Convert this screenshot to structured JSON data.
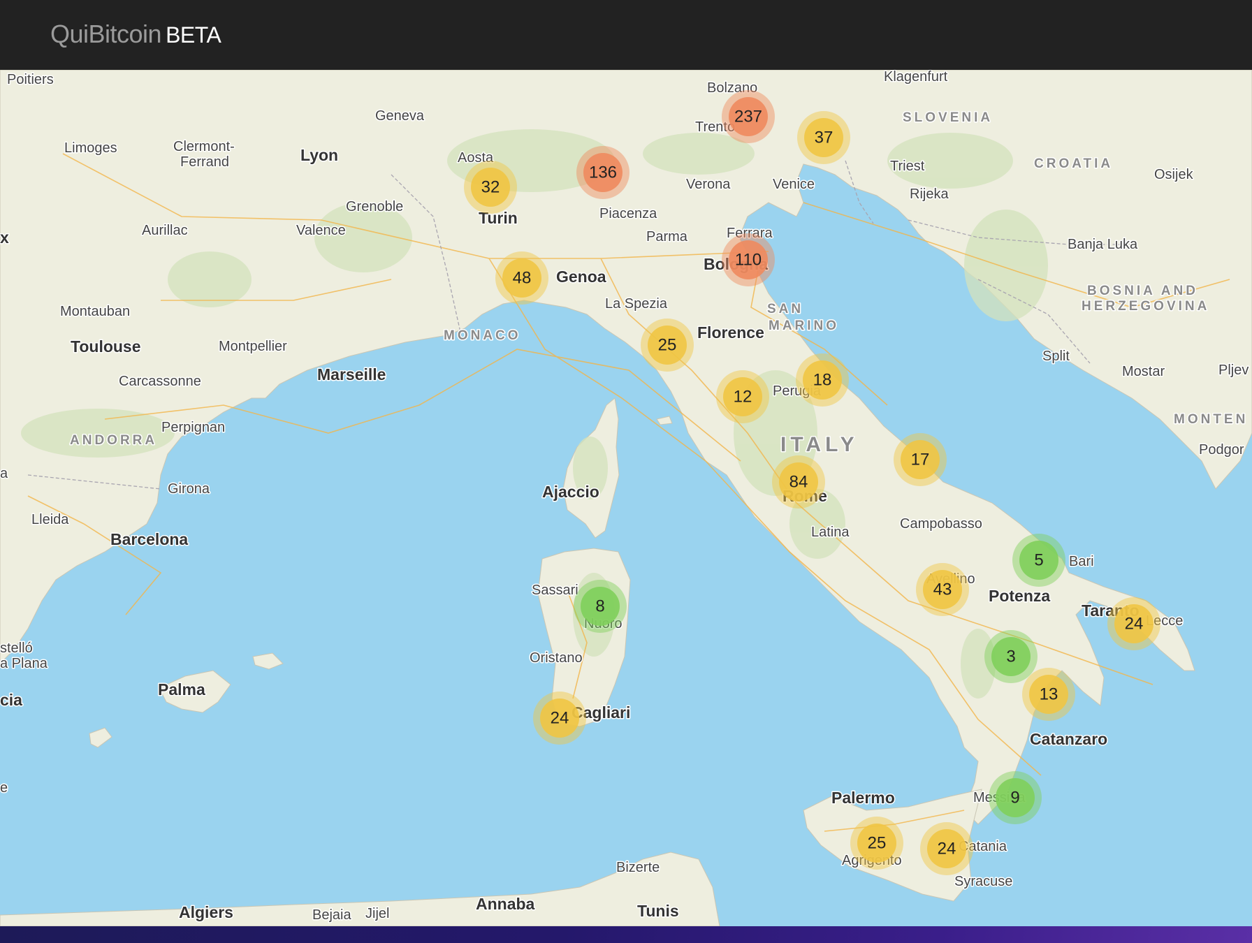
{
  "header": {
    "app_name": "QuiBitcoin",
    "badge": "BETA"
  },
  "colors": {
    "topbar": "#222222",
    "sea": "#9ad3ef",
    "land": "#f1efe4",
    "cluster_small": "#7fcf5b",
    "cluster_medium": "#efc544",
    "cluster_large": "#ee8a5e"
  },
  "map": {
    "country_labels": [
      "SLOVENIA",
      "CROATIA",
      "BOSNIA AND",
      "HERZEGOVINA",
      "SAN",
      "MARINO",
      "MONACO",
      "ANDORRA",
      "ITALY",
      "MONTEN"
    ],
    "city_labels": [
      "Poitiers",
      "Limoges",
      "Clermont-",
      "Ferrand",
      "Geneva",
      "Lyon",
      "Aosta",
      "Grenoble",
      "Turin",
      "Aurillac",
      "Valence",
      "Bolzano",
      "Trento",
      "Klagenfurt",
      "Verona",
      "Venice",
      "Triest",
      "Rijeka",
      "Osijek",
      "Piacenza",
      "Parma",
      "Ferrara",
      "Bologna",
      "Banja Luka",
      "Genoa",
      "La Spezia",
      "Florence",
      "Montauban",
      "Toulouse",
      "Montpellier",
      "Marseille",
      "Carcassonne",
      "Perpignan",
      "Split",
      "Mostar",
      "Pljev",
      "Perugia",
      "Podgor",
      "Girona",
      "Lleida",
      "Barcelona",
      "Ajaccio",
      "Rome",
      "Latina",
      "Campobasso",
      "Bari",
      "Sassari",
      "Nuoro",
      "Avellino",
      "Potenza",
      "Taranto",
      "Lecce",
      "Oristano",
      "Palma",
      "Cagliari",
      "Catanzaro",
      "Palermo",
      "Messina",
      "Agrigento",
      "Catania",
      "Syracuse",
      "Bizerte",
      "Algiers",
      "Bejaia",
      "Jijel",
      "Annaba",
      "Tunis",
      "stelló",
      "a Plana",
      "cia",
      "x",
      "a",
      "e"
    ],
    "clusters": [
      {
        "count": "237",
        "level": "large"
      },
      {
        "count": "37",
        "level": "medium"
      },
      {
        "count": "136",
        "level": "large"
      },
      {
        "count": "32",
        "level": "medium"
      },
      {
        "count": "110",
        "level": "large"
      },
      {
        "count": "48",
        "level": "medium"
      },
      {
        "count": "25",
        "level": "medium"
      },
      {
        "count": "18",
        "level": "medium"
      },
      {
        "count": "12",
        "level": "medium"
      },
      {
        "count": "17",
        "level": "medium"
      },
      {
        "count": "84",
        "level": "medium"
      },
      {
        "count": "5",
        "level": "small"
      },
      {
        "count": "43",
        "level": "medium"
      },
      {
        "count": "8",
        "level": "small"
      },
      {
        "count": "24",
        "level": "medium"
      },
      {
        "count": "3",
        "level": "small"
      },
      {
        "count": "13",
        "level": "medium"
      },
      {
        "count": "24",
        "level": "medium"
      },
      {
        "count": "9",
        "level": "small"
      },
      {
        "count": "25",
        "level": "medium"
      },
      {
        "count": "24",
        "level": "medium"
      }
    ]
  }
}
